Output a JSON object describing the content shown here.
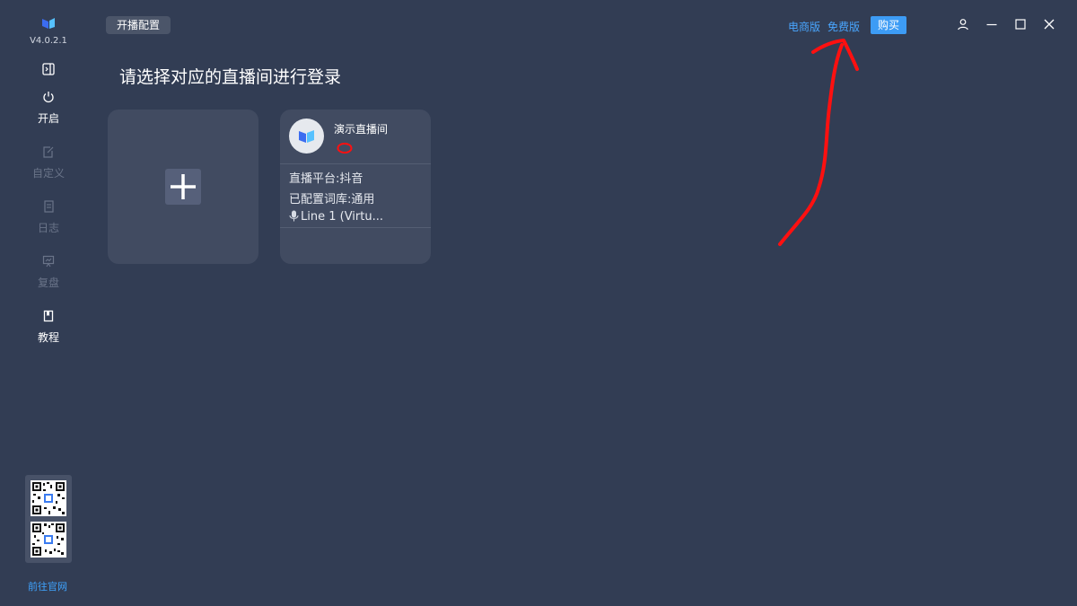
{
  "sidebar": {
    "version": "V4.0.2.1",
    "items": [
      {
        "label": "开启",
        "icon": "power-icon",
        "state": "active"
      },
      {
        "label": "自定义",
        "icon": "edit-icon",
        "state": "disabled"
      },
      {
        "label": "日志",
        "icon": "document-icon",
        "state": "disabled"
      },
      {
        "label": "复盘",
        "icon": "presentation-icon",
        "state": "disabled"
      },
      {
        "label": "教程",
        "icon": "book-icon",
        "state": "active"
      }
    ],
    "site_link": "前往官网"
  },
  "header": {
    "tag": "开播配置",
    "ecommerce_label": "电商版",
    "free_label": "免费版",
    "buy_label": "购买"
  },
  "main": {
    "title": "请选择对应的直播间进行登录",
    "room": {
      "name": "演示直播间",
      "platform": "直播平台:抖音",
      "library": "已配置词库:通用",
      "audio": "Line 1 (Virtu..."
    }
  },
  "colors": {
    "background": "#323d54",
    "card": "#414b61",
    "accent": "#3d9cf5",
    "link": "#49a6ff",
    "annotation": "#ff1010"
  }
}
